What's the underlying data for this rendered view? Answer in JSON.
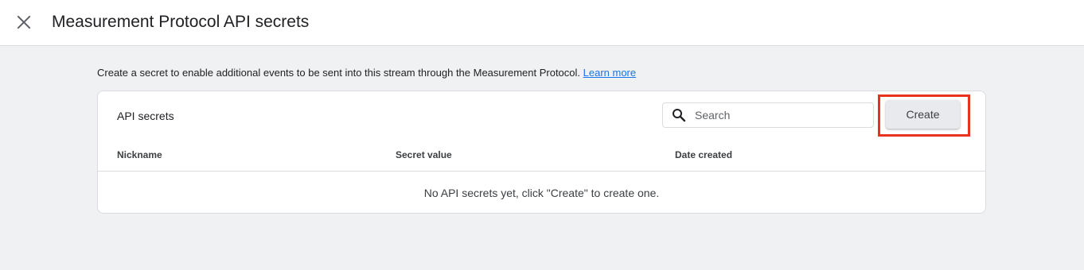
{
  "header": {
    "title": "Measurement Protocol API secrets",
    "close_icon": "close-icon"
  },
  "intro": {
    "text": "Create a secret to enable additional events to be sent into this stream through the Measurement Protocol.",
    "link_label": "Learn more"
  },
  "card": {
    "title": "API secrets",
    "search": {
      "placeholder": "Search",
      "value": "",
      "icon": "search-icon"
    },
    "create_label": "Create",
    "columns": [
      "Nickname",
      "Secret value",
      "Date created"
    ],
    "empty_message": "No API secrets yet, click \"Create\" to create one."
  },
  "colors": {
    "background": "#f0f1f3",
    "link": "#1a73e8",
    "highlight": "#e8321e",
    "button": "#e8eaed"
  }
}
